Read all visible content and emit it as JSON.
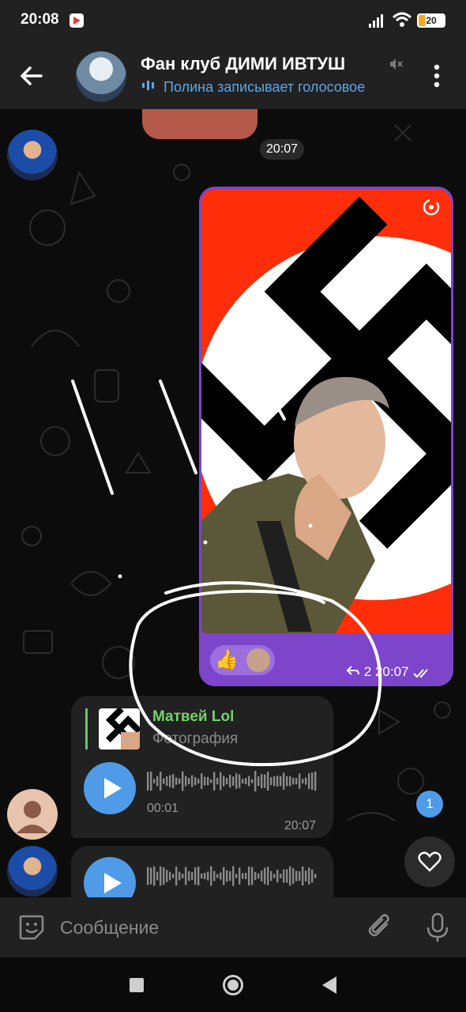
{
  "status_bar": {
    "time": "20:08",
    "battery": "20"
  },
  "header": {
    "title": "Фан клуб ДИМИ ИВТУШ",
    "status": "Полина записывает голосовое"
  },
  "chat": {
    "date_pill": "20:07",
    "photo_message": {
      "reaction_emoji": "👍",
      "reply_count": "2",
      "time": "20:07"
    },
    "voice_message": {
      "quote_name": "Матвей Lol",
      "quote_text": "Фотография",
      "duration": "00:01",
      "time": "20:07"
    },
    "unread_count": "1"
  },
  "input": {
    "placeholder": "Сообщение"
  },
  "colors": {
    "accent": "#4f9be8",
    "bubble_purple": "#7d45c9",
    "quote_green": "#74d36a",
    "header_bg": "#212121"
  }
}
